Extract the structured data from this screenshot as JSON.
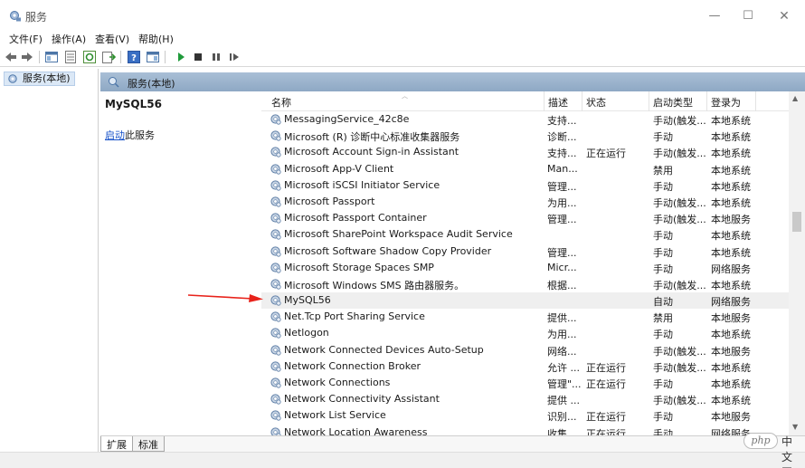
{
  "window": {
    "title": "服务",
    "minimize_glyph": "—",
    "maximize_glyph": "☐",
    "close_glyph": "✕"
  },
  "menu": [
    {
      "label": "文件(F)"
    },
    {
      "label": "操作(A)"
    },
    {
      "label": "查看(V)"
    },
    {
      "label": "帮助(H)"
    }
  ],
  "toolbar": {
    "icons": [
      "back-arrow-icon",
      "forward-arrow-icon",
      "show-hide-tree-icon",
      "export-list-icon",
      "refresh-icon",
      "export-icon",
      "help-icon",
      "properties-icon",
      "start-service-icon",
      "stop-service-icon",
      "pause-service-icon",
      "resume-service-icon"
    ]
  },
  "tree": {
    "item_label": "服务(本地)"
  },
  "right_header": {
    "label": "服务(本地)"
  },
  "details": {
    "service_name": "MySQL56",
    "action_link": "启动",
    "action_suffix": "此服务"
  },
  "columns": {
    "name": "名称",
    "description": "描述",
    "status": "状态",
    "startup_type": "启动类型",
    "logon_as": "登录为"
  },
  "services": [
    {
      "name": "MessagingService_42c8e",
      "description": "支持...",
      "status": "",
      "startup": "手动(触发...",
      "logon": "本地系统"
    },
    {
      "name": "Microsoft (R) 诊断中心标准收集器服务",
      "description": "诊断...",
      "status": "",
      "startup": "手动",
      "logon": "本地系统"
    },
    {
      "name": "Microsoft Account Sign-in Assistant",
      "description": "支持...",
      "status": "正在运行",
      "startup": "手动(触发...",
      "logon": "本地系统"
    },
    {
      "name": "Microsoft App-V Client",
      "description": "Man...",
      "status": "",
      "startup": "禁用",
      "logon": "本地系统"
    },
    {
      "name": "Microsoft iSCSI Initiator Service",
      "description": "管理...",
      "status": "",
      "startup": "手动",
      "logon": "本地系统"
    },
    {
      "name": "Microsoft Passport",
      "description": "为用...",
      "status": "",
      "startup": "手动(触发...",
      "logon": "本地系统"
    },
    {
      "name": "Microsoft Passport Container",
      "description": "管理...",
      "status": "",
      "startup": "手动(触发...",
      "logon": "本地服务"
    },
    {
      "name": "Microsoft SharePoint Workspace Audit Service",
      "description": "",
      "status": "",
      "startup": "手动",
      "logon": "本地系统"
    },
    {
      "name": "Microsoft Software Shadow Copy Provider",
      "description": "管理...",
      "status": "",
      "startup": "手动",
      "logon": "本地系统"
    },
    {
      "name": "Microsoft Storage Spaces SMP",
      "description": "Micr...",
      "status": "",
      "startup": "手动",
      "logon": "网络服务"
    },
    {
      "name": "Microsoft Windows SMS 路由器服务。",
      "description": "根据...",
      "status": "",
      "startup": "手动(触发...",
      "logon": "本地系统"
    },
    {
      "name": "MySQL56",
      "description": "",
      "status": "",
      "startup": "自动",
      "logon": "网络服务",
      "selected": true
    },
    {
      "name": "Net.Tcp Port Sharing Service",
      "description": "提供...",
      "status": "",
      "startup": "禁用",
      "logon": "本地服务"
    },
    {
      "name": "Netlogon",
      "description": "为用...",
      "status": "",
      "startup": "手动",
      "logon": "本地系统"
    },
    {
      "name": "Network Connected Devices Auto-Setup",
      "description": "网络...",
      "status": "",
      "startup": "手动(触发...",
      "logon": "本地服务"
    },
    {
      "name": "Network Connection Broker",
      "description": "允许 ...",
      "status": "正在运行",
      "startup": "手动(触发...",
      "logon": "本地系统"
    },
    {
      "name": "Network Connections",
      "description": "管理\"...",
      "status": "正在运行",
      "startup": "手动",
      "logon": "本地系统"
    },
    {
      "name": "Network Connectivity Assistant",
      "description": "提供 ...",
      "status": "",
      "startup": "手动(触发...",
      "logon": "本地系统"
    },
    {
      "name": "Network List Service",
      "description": "识别...",
      "status": "正在运行",
      "startup": "手动",
      "logon": "本地服务"
    },
    {
      "name": "Network Location Awareness",
      "description": "收集...",
      "status": "正在运行",
      "startup": "手动",
      "logon": "网络服务"
    }
  ],
  "tabs": [
    {
      "label": "扩展"
    },
    {
      "label": "标准"
    }
  ],
  "watermark": {
    "logo_text": "php",
    "site_text": "中文网"
  },
  "colors": {
    "header_band": "#9fb6cf",
    "selected_row": "#efefef",
    "link": "#1550c8",
    "annotation_arrow": "#e8231b"
  }
}
